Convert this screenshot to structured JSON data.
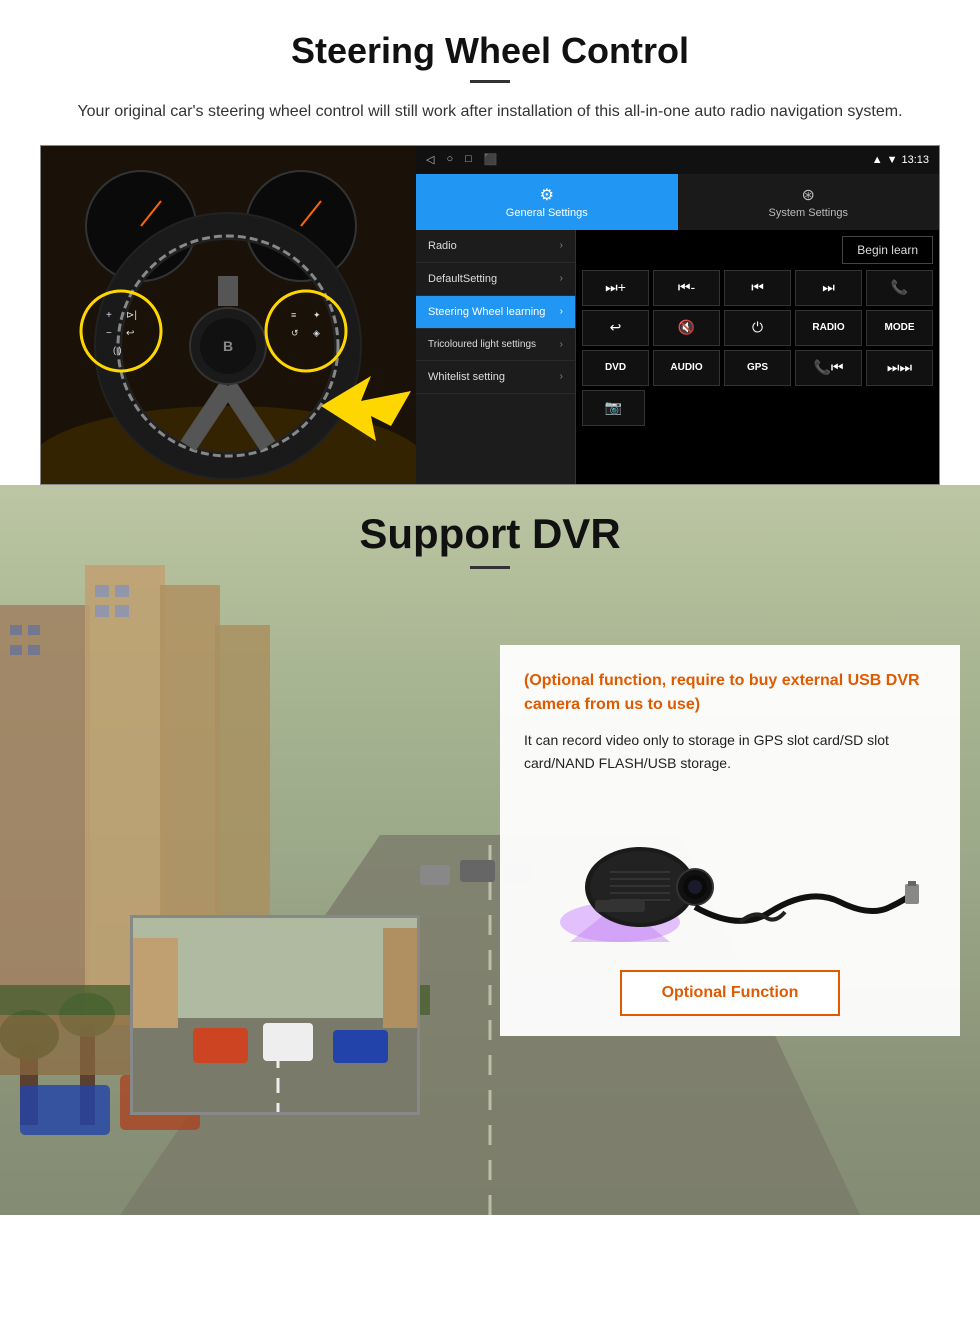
{
  "page": {
    "sections": {
      "steering": {
        "title": "Steering Wheel Control",
        "subtitle": "Your original car's steering wheel control will still work after installation of this all-in-one auto radio navigation system.",
        "android": {
          "statusbar": {
            "time": "13:13",
            "wifi_icon": "▼",
            "signal_icon": "▲"
          },
          "tabs": {
            "general": {
              "icon": "⚙",
              "label": "General Settings"
            },
            "system": {
              "icon": "☆",
              "label": "System Settings"
            }
          },
          "menu_items": [
            {
              "label": "Radio",
              "active": false
            },
            {
              "label": "DefaultSetting",
              "active": false
            },
            {
              "label": "Steering Wheel learning",
              "active": true
            },
            {
              "label": "Tricoloured light settings",
              "active": false
            },
            {
              "label": "Whitelist setting",
              "active": false
            }
          ],
          "begin_learn_label": "Begin learn",
          "control_buttons_row1": [
            "⏮+",
            "⏮-",
            "⏮",
            "⏭",
            "📞"
          ],
          "control_buttons_row2": [
            "↩",
            "🔇",
            "⏻",
            "RADIO",
            "MODE"
          ],
          "control_buttons_row3": [
            "DVD",
            "AUDIO",
            "GPS",
            "📞⏮",
            "⏭⏭"
          ],
          "control_buttons_row4": [
            "📷"
          ]
        }
      },
      "dvr": {
        "title": "Support DVR",
        "info_card": {
          "optional_text": "(Optional function, require to buy external USB DVR camera from us to use)",
          "description": "It can record video only to storage in GPS slot card/SD slot card/NAND FLASH/USB storage.",
          "optional_btn_label": "Optional Function"
        }
      }
    }
  }
}
